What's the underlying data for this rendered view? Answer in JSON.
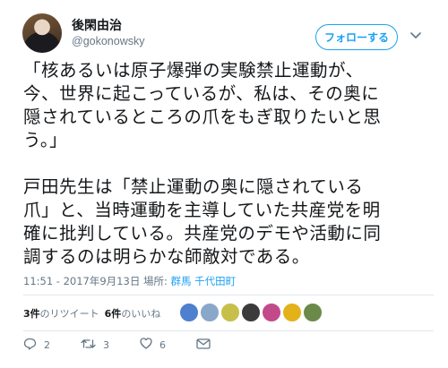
{
  "user": {
    "display_name": "後閑由治",
    "handle": "@gokonowsky"
  },
  "follow_button": {
    "label": "フォローする"
  },
  "tweet": {
    "text": "「核あるいは原子爆弾の実験禁止運動が、\n今、世界に起こっているが、私は、その奥に\n隠されているところの爪をもぎ取りたいと思\nう。」\n\n戸田先生は「禁止運動の奥に隠されている\n爪」と、当時運動を主導していた共産党を明\n確に批判している。共産党のデモや活動に同\n調するのは明らかな師敵対である。",
    "timestamp": "11:51 - 2017年9月13日 場所: ",
    "location": "群馬 千代田町"
  },
  "stats": {
    "retweets_count": "3件",
    "retweets_label": "のリツイート",
    "likes_count": "6件",
    "likes_label": "のいいね"
  },
  "likers": [
    {
      "name": "liker-avatar-1",
      "color": "#4f7fcf"
    },
    {
      "name": "liker-avatar-2",
      "color": "#89a8c9"
    },
    {
      "name": "liker-avatar-3",
      "color": "#c6c04a"
    },
    {
      "name": "liker-avatar-4",
      "color": "#3b3b3b"
    },
    {
      "name": "liker-avatar-5",
      "color": "#c24a8b"
    },
    {
      "name": "liker-avatar-6",
      "color": "#e3b21a"
    },
    {
      "name": "liker-avatar-7",
      "color": "#6b8a4a"
    }
  ],
  "actions": {
    "reply_count": "2",
    "retweet_count": "3",
    "like_count": "6"
  },
  "colors": {
    "accent": "#1da1f2",
    "muted": "#657786",
    "divider": "#e1e8ed"
  }
}
